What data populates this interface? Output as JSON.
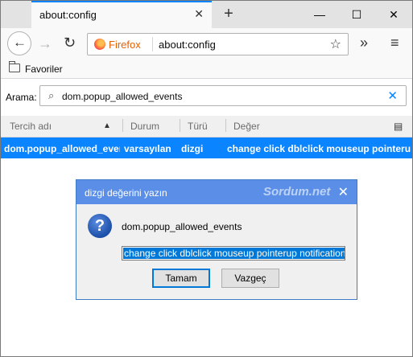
{
  "tab": {
    "title": "about:config",
    "close": "✕"
  },
  "newtab": "+",
  "window_controls": {
    "minimize": "—",
    "maximize": "☐",
    "close": "✕"
  },
  "nav": {
    "back": "←",
    "forward": "→",
    "reload": "↻",
    "identity_label": "Firefox",
    "url": "about:config",
    "bookmark_star": "☆",
    "overflow": "»",
    "menu": "≡"
  },
  "bookmarks": {
    "folder_label": "Favoriler"
  },
  "search": {
    "label": "Arama:",
    "icon": "⌕",
    "value": "dom.popup_allowed_events",
    "clear": "✕"
  },
  "table": {
    "headers": [
      "Tercih adı",
      "Durum",
      "Türü",
      "Değer"
    ],
    "sort_indicator": "▲",
    "column_picker": "▤",
    "rows": [
      [
        "dom.popup_allowed_even...",
        "varsayılan",
        "dizgi",
        "change click dblclick mouseup pointerup..."
      ]
    ]
  },
  "dialog": {
    "title": "dizgi değerini yazın",
    "watermark": "Sordum.net",
    "close": "✕",
    "icon": "?",
    "message": "dom.popup_allowed_events",
    "input_value": "change click dblclick mouseup pointerup notification",
    "ok": "Tamam",
    "cancel": "Vazgeç"
  },
  "colors": {
    "accent": "#0a84ff",
    "dialog_title": "#5b8ee6",
    "selection": "#0078d7"
  }
}
